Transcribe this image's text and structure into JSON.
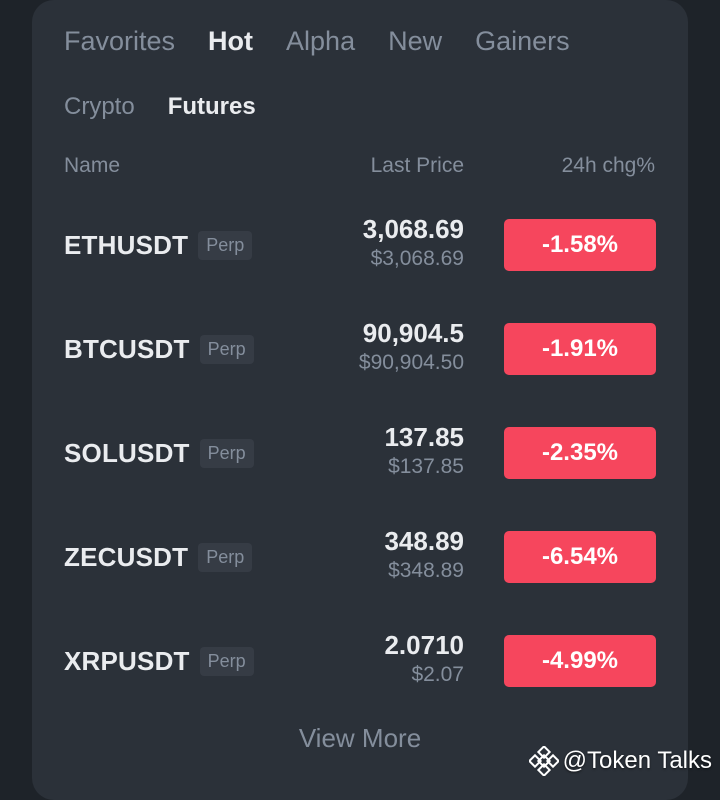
{
  "tabs_primary": [
    {
      "label": "Favorites",
      "active": false
    },
    {
      "label": "Hot",
      "active": true
    },
    {
      "label": "Alpha",
      "active": false
    },
    {
      "label": "New",
      "active": false
    },
    {
      "label": "Gainers",
      "active": false
    }
  ],
  "tabs_secondary": [
    {
      "label": "Crypto",
      "active": false
    },
    {
      "label": "Futures",
      "active": true
    }
  ],
  "columns": {
    "name": "Name",
    "price": "Last Price",
    "change": "24h chg%"
  },
  "rows": [
    {
      "symbol": "ETHUSDT",
      "tag": "Perp",
      "price": "3,068.69",
      "price_usd": "$3,068.69",
      "change": "-1.58%"
    },
    {
      "symbol": "BTCUSDT",
      "tag": "Perp",
      "price": "90,904.5",
      "price_usd": "$90,904.50",
      "change": "-1.91%"
    },
    {
      "symbol": "SOLUSDT",
      "tag": "Perp",
      "price": "137.85",
      "price_usd": "$137.85",
      "change": "-2.35%"
    },
    {
      "symbol": "ZECUSDT",
      "tag": "Perp",
      "price": "348.89",
      "price_usd": "$348.89",
      "change": "-6.54%"
    },
    {
      "symbol": "XRPUSDT",
      "tag": "Perp",
      "price": "2.0710",
      "price_usd": "$2.07",
      "change": "-4.99%"
    }
  ],
  "view_more": "View More",
  "watermark": {
    "text": "@Token Talks",
    "icon": "binance-logo-icon"
  },
  "colors": {
    "background": "#1e2329",
    "card": "#2b3139",
    "negative": "#f6465d",
    "muted": "#848e9c",
    "text": "#eaecef"
  }
}
